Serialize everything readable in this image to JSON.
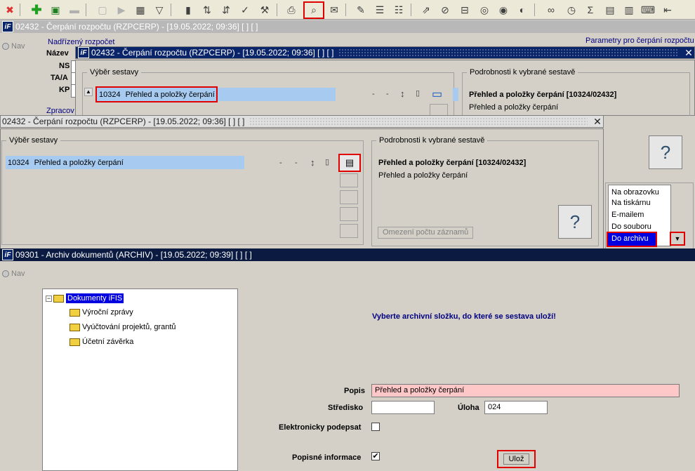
{
  "toolbar": {
    "icons": [
      "close-icon",
      "add-icon",
      "save-icon",
      "minus-icon",
      "blank-icon",
      "play-icon",
      "calendar-icon",
      "filter-icon",
      "chart-icon",
      "sort-asc-icon",
      "sort-desc-icon",
      "check-icon",
      "wrench-icon",
      "print-icon",
      "print-preview-icon",
      "mail-icon",
      "edit-icon",
      "list-icon",
      "checklist-icon",
      "export-icon",
      "attach-icon",
      "link-icon",
      "globe-icon",
      "compass-icon",
      "eye-icon",
      "glasses-icon",
      "clock-icon",
      "sum-icon",
      "excel-icon",
      "xml-icon",
      "keyboard-icon",
      "back-icon"
    ]
  },
  "bg_window": {
    "title": "02432 - Čerpání rozpočtu (RZPCERP) - [19.05.2022; 09:36]  [ ]  [ ]",
    "nav": "Nav",
    "nadrizeny": "Nadřízený rozpočet",
    "parametry": "Parametry pro čerpání rozpočtu",
    "nazev": "Název",
    "ns": "NS",
    "taa": "TA/A",
    "kp": "KP",
    "zpracov": "Zpracov"
  },
  "dialog1": {
    "title": "02432 - Čerpání rozpočtu (RZPCERP) - [19.05.2022; 09:36]  [ ]  [ ]",
    "vyber": "Výběr sestavy",
    "code": "10324",
    "name": "Přehled a položky čerpání",
    "details_legend": "Podrobnosti k vybrané sestavě",
    "details_title": "Přehled a položky čerpání [10324/02432]",
    "details_sub": "Přehled a položky čerpání",
    "dash1": "-",
    "dash2": "-"
  },
  "dialog2": {
    "title": "02432 - Čerpání rozpočtu (RZPCERP) - [19.05.2022; 09:36]  [ ]  [ ]",
    "vyber": "Výběr sestavy",
    "code": "10324",
    "name": "Přehled a položky čerpání",
    "details_legend": "Podrobnosti k vybrané sestavě",
    "details_title": "Přehled a položky čerpání [10324/02432]",
    "details_sub": "Přehled a položky čerpání",
    "omezeni": "Omezení počtu záznamů",
    "dash1": "-",
    "dash2": "-"
  },
  "dropdown": {
    "items": [
      "Na obrazovku",
      "Na tiskárnu",
      "E-mailem",
      "Do souboru",
      "Do archivu"
    ],
    "selected": "Do archivu"
  },
  "archiv": {
    "title": "09301 - Archiv dokumentů (ARCHIV) - [19.05.2022; 09:39]  [ ]  [ ]",
    "nav": "Nav",
    "tree_root": "Dokumenty iFIS",
    "tree_items": [
      "Výroční zprávy",
      "Vyúčtování projektů, grantů",
      "Účetní závěrka"
    ],
    "instruction": "Vyberte archivní složku, do které se sestava uloží!",
    "popis_label": "Popis",
    "popis_value": "Přehled a položky čerpání",
    "stredisko_label": "Středisko",
    "stredisko_value": "",
    "uloha_label": "Úloha",
    "uloha_value": "024",
    "elektronicky_label": "Elektronicky podepsat",
    "elektronicky_checked": "",
    "popisne_label": "Popisné informace",
    "popisne_checked": "✔",
    "uloz_label": "Ulož"
  }
}
